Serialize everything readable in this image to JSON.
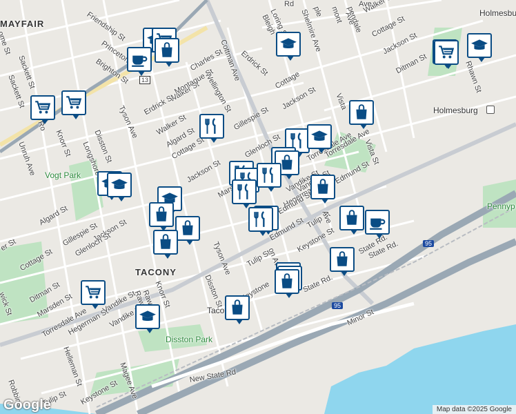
{
  "map": {
    "attribution": "Map data ©2025 Google",
    "logo": "Google",
    "colors": {
      "water": "#8fd6ee",
      "park": "#bfe3c2",
      "highway": "#9aa8b4",
      "road": "#ffffff",
      "land": "#ebe9e4",
      "pin": "#0a4c84",
      "accent": "#e8d9a0"
    },
    "neighborhoods": [
      "MAYFAIR",
      "TACONY",
      "Holmesbu",
      "Holmesburg"
    ],
    "parks": [
      "Vogt Park",
      "Disston Park",
      "Pennyp the De",
      "Taco"
    ],
    "interstate_shields": [
      "95",
      "95"
    ],
    "route_shields": [
      "13"
    ],
    "streets": [
      "Friendship St",
      "Walker St",
      "Cottage St",
      "Jackson St",
      "Ditman St",
      "Rhawn St",
      "Erdrick St",
      "Loring St",
      "Bleigh",
      "Shelmire Ave",
      "Princeton",
      "Brighton St",
      "Sackett St",
      "Charles St",
      "Cottman Ave",
      "Wellington St",
      "Walker St",
      "Montague St",
      "Tyson Ave",
      "Erdrick St",
      "Walker St",
      "Algard St",
      "Cottage St",
      "Gillespie St",
      "Jackson St",
      "Glenloch St",
      "Disston St",
      "Longshore Ave",
      "Knorr St",
      "Unruh Ave",
      "Marsden",
      "Vandike St",
      "Torresdale Ave",
      "Vista St",
      "Edmund St",
      "Hegerman",
      "Tulip St",
      "Keystone St",
      "State Rd.",
      "Algard St",
      "Gillespie St",
      "Jackson St",
      "Glenloch St",
      "Cottage St",
      "Ditman St",
      "Marsden St",
      "Torresdale Ave",
      "Hegerman St",
      "Vandike St",
      "Helleman St",
      "Magee Ave",
      "Keystone St",
      "New State Rd",
      "Robbins",
      "Tulip St",
      "Disston St",
      "Tyson Ave",
      "Knorr St",
      "Rawn St",
      "Keystone",
      "Edmund St",
      "Tulip St",
      "Minor St",
      "State Rd.",
      "State Rd.",
      "Cottage",
      "Jackson St",
      "Rd",
      "Ave",
      "Ave",
      "mont",
      "ple",
      "pendale",
      "Ave",
      "Vista",
      "Torresdale Ave",
      "Vandike St",
      "Edmund St",
      "on Ave",
      "wick St",
      "er St",
      "Ro",
      "ome St",
      "Vandike St",
      "Rawn St",
      "Sackett St"
    ],
    "pins": [
      {
        "icon": "education"
      },
      {
        "icon": "cart"
      },
      {
        "icon": "shopping-bag"
      },
      {
        "icon": "coffee"
      },
      {
        "icon": "cart"
      },
      {
        "icon": "cart"
      },
      {
        "icon": "education"
      },
      {
        "icon": "education"
      },
      {
        "icon": "cart"
      },
      {
        "icon": "education"
      },
      {
        "icon": "shopping-bag"
      },
      {
        "icon": "restaurant"
      },
      {
        "icon": "restaurant"
      },
      {
        "icon": "education"
      },
      {
        "icon": "restaurant"
      },
      {
        "icon": "shopping-bag"
      },
      {
        "icon": "restaurant"
      },
      {
        "icon": "restaurant"
      },
      {
        "icon": "restaurant"
      },
      {
        "icon": "shopping-bag"
      },
      {
        "icon": "education"
      },
      {
        "icon": "education"
      },
      {
        "icon": "education"
      },
      {
        "icon": "shopping-bag"
      },
      {
        "icon": "restaurant"
      },
      {
        "icon": "shopping-bag"
      },
      {
        "icon": "shopping-bag"
      },
      {
        "icon": "restaurant"
      },
      {
        "icon": "shopping-bag"
      },
      {
        "icon": "coffee"
      },
      {
        "icon": "shopping-bag"
      },
      {
        "icon": "cart"
      },
      {
        "icon": "shopping-bag"
      },
      {
        "icon": "cart"
      },
      {
        "icon": "shopping-bag"
      },
      {
        "icon": "education"
      },
      {
        "icon": "shopping-bag"
      },
      {
        "icon": "restaurant"
      }
    ]
  }
}
